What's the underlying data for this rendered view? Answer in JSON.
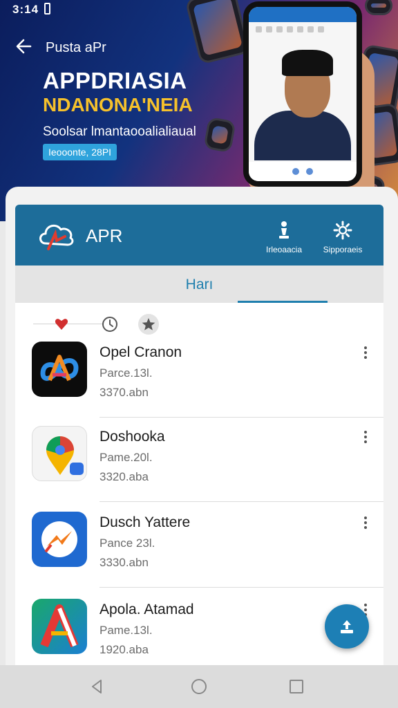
{
  "status_bar": {
    "time": "3:14"
  },
  "banner": {
    "nav_title": "Pusta aPr",
    "title": "APPDRIASIA",
    "subtitle": "NDANONA'NEIA",
    "tagline": "Soolsar lmantaooalialiaual",
    "pill": "Ieooonte, 28PI"
  },
  "app_header": {
    "name": "APR",
    "btn_left_label": "Irleoaacia",
    "btn_right_label": "Sipporaeis"
  },
  "tabs": {
    "active": "Harı"
  },
  "apps": [
    {
      "title": "Opel Cranon",
      "meta1": "Parce.13l.",
      "meta2": "3370.abn",
      "icon": "infinity-logo-icon"
    },
    {
      "title": "Doshooka",
      "meta1": "Pame.20l.",
      "meta2": "3320.aba",
      "icon": "map-pin-icon"
    },
    {
      "title": "Dusch Yattere",
      "meta1": "Pance 23l.",
      "meta2": "3330.abn",
      "icon": "messenger-bolt-icon"
    },
    {
      "title": "Apola. Atamad",
      "meta1": "Pame.13l.",
      "meta2": "1920.aba",
      "icon": "letter-a-icon"
    }
  ],
  "colors": {
    "header": "#1d6d9a",
    "accent": "#1f7fae",
    "fab": "#1d7fb5",
    "banner_accent": "#f6c12b"
  }
}
